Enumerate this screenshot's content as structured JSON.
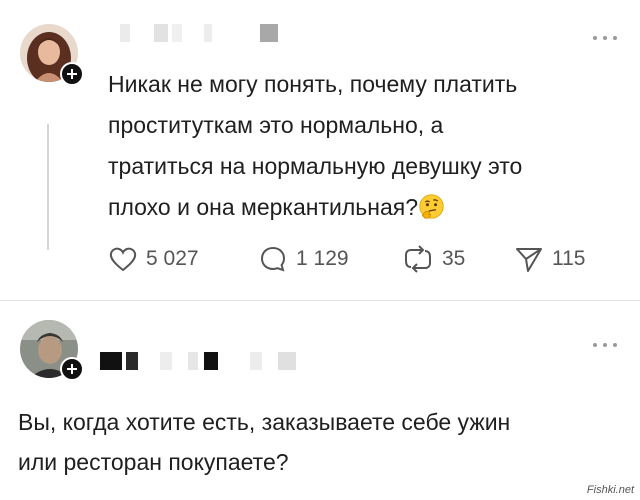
{
  "post1": {
    "text_lines": [
      "Никак не могу понять, почему платить",
      "проституткам это нормально, а",
      "тратиться на нормальную девушку это",
      "плохо и она меркантильная?"
    ],
    "emoji": "thinking-face",
    "actions": {
      "likes": "5 027",
      "comments": "1 129",
      "reposts": "35",
      "shares": "115"
    }
  },
  "post2": {
    "text_lines": [
      "Вы, когда хотите есть, заказываете себе ужин",
      "или ресторан покупаете?"
    ]
  },
  "watermark": "Fishki.net",
  "colors": {
    "text": "#1f1f1f",
    "muted": "#555555",
    "badge": "#111111",
    "divider": "#e0e0e0"
  }
}
